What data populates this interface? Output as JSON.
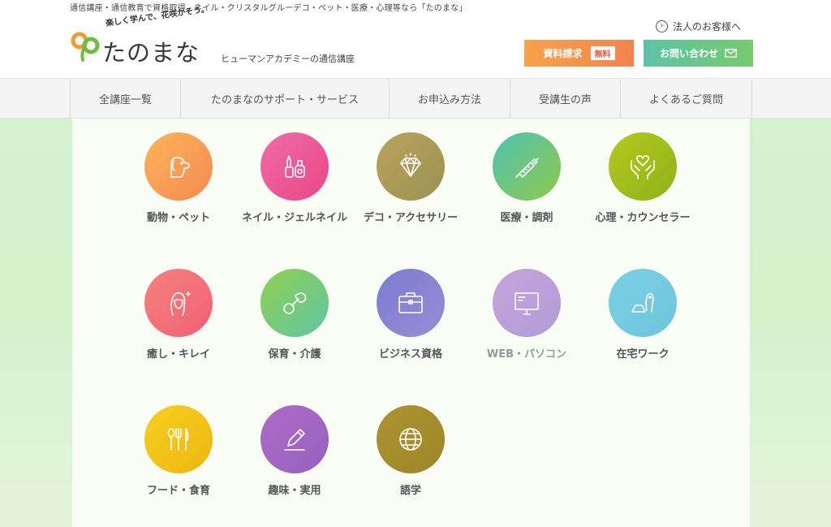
{
  "header": {
    "tagline": "通信講座・通信教育で資格取得、ネイル・クリスタルグルーデコ・ペット・医療・心理等なら「たのまな」",
    "logo_catch": "楽しく学んで、花咲かそう。",
    "logo_text": "たのまな",
    "logo_sub": "ヒューマンアカデミーの通信講座",
    "corp_link": "法人のお客様へ",
    "request_button": "資料請求",
    "request_badge": "無料",
    "contact_button": "お問い合わせ"
  },
  "nav": {
    "items": [
      {
        "label": "全講座一覧"
      },
      {
        "label": "たのまなのサポート・サービス"
      },
      {
        "label": "お申込み方法"
      },
      {
        "label": "受講生の声"
      },
      {
        "label": "よくあるご質問"
      }
    ]
  },
  "categories": [
    {
      "label": "動物・ペット",
      "icon": "dog-icon",
      "color": "#f8a155"
    },
    {
      "label": "ネイル・ジェルネイル",
      "icon": "nail-polish-icon",
      "color": "#ee4f9a"
    },
    {
      "label": "デコ・アクセサリー",
      "icon": "diamond-icon",
      "color": "#a99a58"
    },
    {
      "label": "医療・調剤",
      "icon": "syringe-icon",
      "color": "#6cc47f"
    },
    {
      "label": "心理・カウンセラー",
      "icon": "hands-heart-icon",
      "color": "#a3bf1b"
    },
    {
      "label": "癒し・キレイ",
      "icon": "woman-sparkle-icon",
      "color": "#f47474"
    },
    {
      "label": "保育・介護",
      "icon": "pacifier-icon",
      "color": "#86cc62"
    },
    {
      "label": "ビジネス資格",
      "icon": "briefcase-icon",
      "color": "#8a84d3"
    },
    {
      "label": "WEB・パソコン",
      "icon": "monitor-icon",
      "color": "#bb9fd8"
    },
    {
      "label": "在宅ワーク",
      "icon": "laptop-person-icon",
      "color": "#79cce2"
    },
    {
      "label": "フード・食育",
      "icon": "cutlery-icon",
      "color": "#f0c419"
    },
    {
      "label": "趣味・実用",
      "icon": "pen-icon",
      "color": "#a26ac4"
    },
    {
      "label": "語学",
      "icon": "globe-icon",
      "color": "#a88c2e"
    }
  ]
}
